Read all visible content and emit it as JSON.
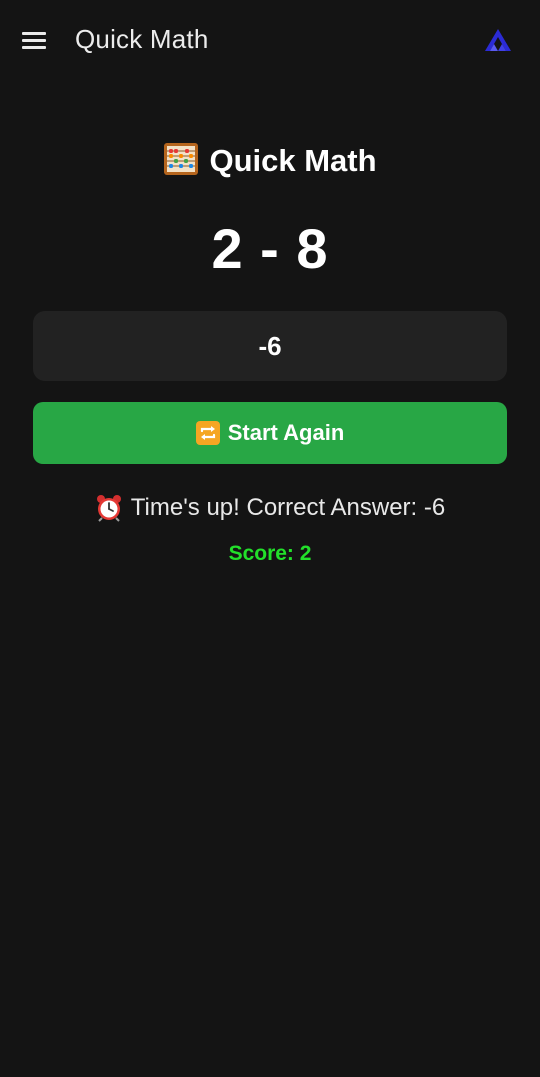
{
  "header": {
    "title": "Quick Math",
    "menu_icon": "hamburger-menu-icon",
    "logo_icon": "brand-logo-icon"
  },
  "game": {
    "heading_icon": "abacus-icon",
    "heading": "Quick Math",
    "problem": "2 - 8",
    "answer_value": "-6",
    "start_button_icon": "repeat-icon",
    "start_button_label": "Start Again",
    "result_icon": "alarm-clock-icon",
    "result_text": "Time's up! Correct Answer: -6",
    "score_text": "Score: 2"
  },
  "colors": {
    "background": "#141414",
    "button_green": "#28a745",
    "score_green": "#22e02a",
    "logo_blue": "#2b2bd6",
    "input_bg": "#222222"
  }
}
